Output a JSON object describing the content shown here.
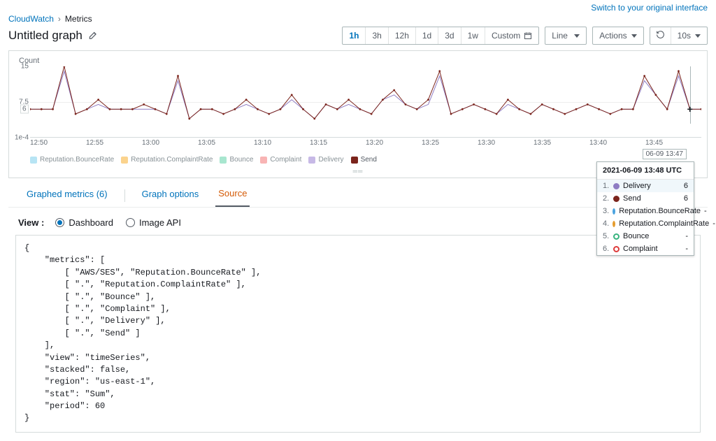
{
  "top_interface_link": "Switch to your original interface",
  "breadcrumb": {
    "root": "CloudWatch",
    "here": "Metrics"
  },
  "title": "Untitled graph",
  "time_ranges": [
    "1h",
    "3h",
    "12h",
    "1d",
    "3d",
    "1w",
    "Custom"
  ],
  "time_active": 0,
  "viz_type": "Line",
  "actions_label": "Actions",
  "refresh_interval": "10s",
  "cursor_time_badge": "06-09 13:47",
  "chart_data": {
    "type": "line",
    "ylabel": "Count",
    "ylim": [
      0.0001,
      15
    ],
    "yticks": [
      {
        "label": "15",
        "v": 15
      },
      {
        "label": "7.5",
        "v": 7.5
      },
      {
        "label": "1e-4",
        "v": 0.0001
      }
    ],
    "y_marker": {
      "label": "6",
      "v": 6
    },
    "x_ticks": [
      "12:50",
      "12:55",
      "13:00",
      "13:05",
      "13:10",
      "13:15",
      "13:20",
      "13:25",
      "13:30",
      "13:35",
      "13:40",
      "13:45"
    ],
    "x_count": 60,
    "cursor_index": 58,
    "series": [
      {
        "name": "Reputation.BounceRate",
        "color": "#b7e4f4",
        "active": false
      },
      {
        "name": "Reputation.ComplaintRate",
        "color": "#fbd38d",
        "active": false
      },
      {
        "name": "Bounce",
        "color": "#a8e6cf",
        "active": false
      },
      {
        "name": "Complaint",
        "color": "#f8b4b4",
        "active": false
      },
      {
        "name": "Delivery",
        "color": "#c7b9e6",
        "active": false
      },
      {
        "name": "Send",
        "color": "#7b241c",
        "active": true,
        "values": [
          6,
          6,
          6,
          15,
          5,
          6,
          8,
          6,
          6,
          6,
          7,
          6,
          5,
          13,
          4,
          6,
          6,
          5,
          6,
          8,
          6,
          5,
          6,
          9,
          6,
          4,
          7,
          6,
          8,
          6,
          5,
          8,
          10,
          7,
          6,
          8,
          14,
          5,
          6,
          7,
          6,
          5,
          8,
          6,
          5,
          7,
          6,
          5,
          6,
          7,
          6,
          5,
          6,
          6,
          13,
          9,
          6,
          14,
          6,
          6
        ]
      }
    ],
    "overlay": {
      "name": "Delivery",
      "color": "#8e7cc3",
      "values": [
        6,
        6,
        6,
        14,
        5,
        6,
        7,
        6,
        6,
        6,
        6,
        6,
        5,
        12,
        4,
        6,
        6,
        5,
        6,
        7,
        6,
        5,
        6,
        8,
        6,
        4,
        7,
        6,
        7,
        6,
        5,
        8,
        9,
        7,
        6,
        7,
        13,
        5,
        6,
        7,
        6,
        5,
        7,
        6,
        5,
        7,
        6,
        5,
        6,
        7,
        6,
        5,
        6,
        6,
        12,
        9,
        6,
        13,
        6,
        6
      ]
    }
  },
  "tooltip": {
    "title": "2021-06-09 13:48 UTC",
    "rows": [
      {
        "n": "1.",
        "name": "Delivery",
        "color": "#8e7cc3",
        "val": "6",
        "filled": true,
        "highlight": true
      },
      {
        "n": "2.",
        "name": "Send",
        "color": "#7b241c",
        "val": "6",
        "filled": true
      },
      {
        "n": "3.",
        "name": "Reputation.BounceRate",
        "color": "#4aa3df",
        "val": "-",
        "filled": false
      },
      {
        "n": "4.",
        "name": "Reputation.ComplaintRate",
        "color": "#e59c2e",
        "val": "-",
        "filled": false
      },
      {
        "n": "5.",
        "name": "Bounce",
        "color": "#36b37e",
        "val": "-",
        "filled": false
      },
      {
        "n": "6.",
        "name": "Complaint",
        "color": "#de3b3b",
        "val": "-",
        "filled": false
      }
    ]
  },
  "tabs": [
    {
      "label": "Graphed metrics (6)",
      "active": false
    },
    {
      "label": "Graph options",
      "active": false
    },
    {
      "label": "Source",
      "active": true
    }
  ],
  "view": {
    "label": "View :",
    "options": [
      "Dashboard",
      "Image API"
    ],
    "selected": 0
  },
  "source_text": "{\n    \"metrics\": [\n        [ \"AWS/SES\", \"Reputation.BounceRate\" ],\n        [ \".\", \"Reputation.ComplaintRate\" ],\n        [ \".\", \"Bounce\" ],\n        [ \".\", \"Complaint\" ],\n        [ \".\", \"Delivery\" ],\n        [ \".\", \"Send\" ]\n    ],\n    \"view\": \"timeSeries\",\n    \"stacked\": false,\n    \"region\": \"us-east-1\",\n    \"stat\": \"Sum\",\n    \"period\": 60\n}"
}
